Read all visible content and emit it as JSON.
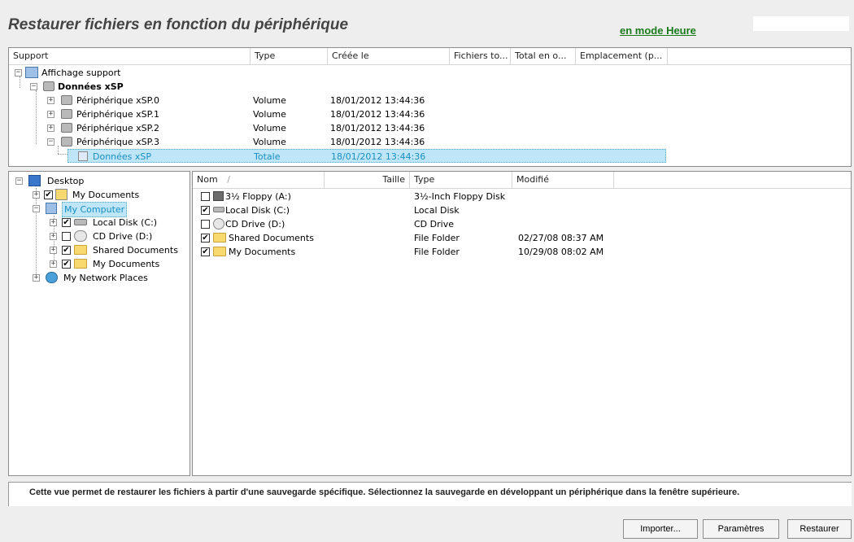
{
  "header": {
    "title": "Restaurer fichiers en fonction du périphérique",
    "mode_link": "en mode Heure"
  },
  "top_table": {
    "columns": [
      "Support",
      "Type",
      "Créée le",
      "Fichiers to...",
      "Total en o...",
      "Emplacement (p..."
    ],
    "root_label": "Affichage support",
    "group_label": "Données xSP",
    "rows": [
      {
        "name": "Périphérique xSP.0",
        "type": "Volume",
        "created": "18/01/2012 13:44:36"
      },
      {
        "name": "Périphérique xSP.1",
        "type": "Volume",
        "created": "18/01/2012 13:44:36"
      },
      {
        "name": "Périphérique xSP.2",
        "type": "Volume",
        "created": "18/01/2012 13:44:36"
      },
      {
        "name": "Périphérique xSP.3",
        "type": "Volume",
        "created": "18/01/2012 13:44:36"
      }
    ],
    "selected_row": {
      "name": "Données xSP",
      "type": "Totale",
      "created": "18/01/2012 13:44:36"
    }
  },
  "tree": {
    "desktop": "Desktop",
    "my_documents": "My Documents",
    "my_computer": "My Computer",
    "local_disk": "Local Disk (C:)",
    "cd_drive": "CD Drive (D:)",
    "shared_documents": "Shared Documents",
    "my_documents_2": "My Documents",
    "network": "My Network Places"
  },
  "file_list": {
    "columns": [
      "Nom",
      "/",
      "Taille",
      "Type",
      "Modifié"
    ],
    "rows": [
      {
        "name": "3½ Floppy (A:)",
        "type": "3½-Inch Floppy Disk",
        "modified": "",
        "checked": false
      },
      {
        "name": "Local Disk (C:)",
        "type": "Local Disk",
        "modified": "",
        "checked": true
      },
      {
        "name": "CD Drive (D:)",
        "type": "CD Drive",
        "modified": "",
        "checked": false
      },
      {
        "name": "Shared Documents",
        "type": "File Folder",
        "modified": "02/27/08 08:37 AM",
        "checked": true
      },
      {
        "name": "My Documents",
        "type": "File Folder",
        "modified": "10/29/08 08:02 AM",
        "checked": true
      }
    ]
  },
  "status_text": "Cette vue permet de restaurer les fichiers à partir d'une sauvegarde spécifique. Sélectionnez la sauvegarde en développant un périphérique dans la fenêtre supérieure.",
  "buttons": {
    "import": "Importer...",
    "settings": "Paramètres",
    "restore": "Restaurer"
  },
  "checkmark": "✔",
  "expander_plus": "+",
  "expander_minus": "−"
}
